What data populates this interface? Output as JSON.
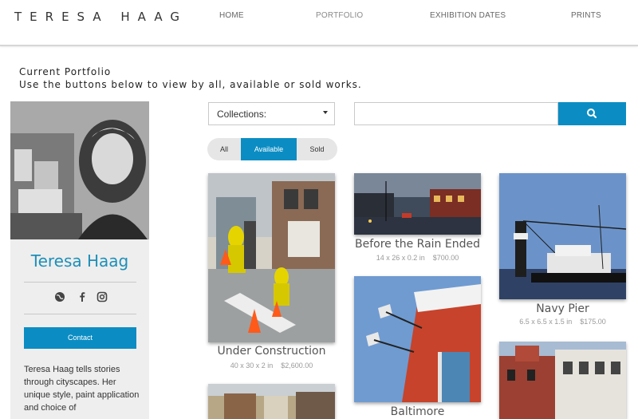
{
  "header": {
    "logo": "TERESA HAAG",
    "nav": [
      "HOME",
      "PORTFOLIO",
      "EXHIBITION DATES",
      "PRINTS"
    ]
  },
  "intro": {
    "title": "Current Portfolio",
    "subtitle": "Use the buttons below to view by all, available or sold works."
  },
  "sidebar": {
    "name": "Teresa Haag",
    "social_icons": [
      "globe-icon",
      "facebook-icon",
      "instagram-icon"
    ],
    "contact_label": "Contact",
    "bio": "Teresa Haag tells stories through cityscapes. Her unique style, paint application and choice of"
  },
  "controls": {
    "collections_label": "Collections:",
    "search_placeholder": "",
    "search_icon": "search-icon",
    "filters": [
      "All",
      "Available",
      "Sold"
    ],
    "active_filter": "Available"
  },
  "artworks": [
    {
      "title": "Under Construction",
      "size": "40 x 30 x 2 in",
      "price": "$2,600.00"
    },
    {
      "title": "Before the Rain Ended",
      "size": "14 x 26 x 0.2 in",
      "price": "$700.00"
    },
    {
      "title": "Navy Pier",
      "size": "6.5 x 6.5 x 1.5 in",
      "price": "$175.00"
    },
    {
      "title": "Baltimore",
      "size": "",
      "price": ""
    }
  ],
  "colors": {
    "accent": "#0b8dc3",
    "name_color": "#1e8fb8"
  }
}
